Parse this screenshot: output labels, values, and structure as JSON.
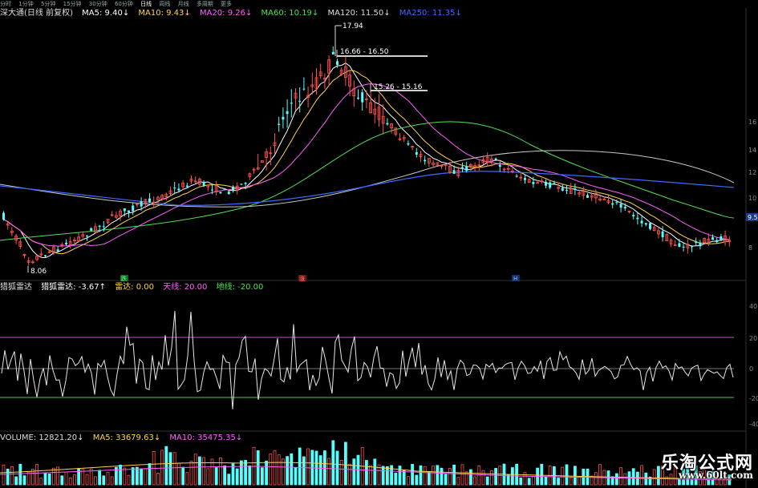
{
  "toolbar": {
    "items": [
      "分时",
      "1分钟",
      "5分钟",
      "15分钟",
      "30分钟",
      "60分钟",
      "日线",
      "周线",
      "月线",
      "多周期",
      "更多"
    ],
    "active_index": 6
  },
  "header": {
    "name": "深大通(日线 前复权)",
    "ma5": "MA5: 9.40↓",
    "ma10": "MA10: 9.43↓",
    "ma20": "MA20: 9.26↓",
    "ma60": "MA60: 10.19↓",
    "ma120": "MA120: 11.50↓",
    "ma250": "MA250: 11.35↓"
  },
  "annotations": {
    "high": "17.94",
    "low": "8.06",
    "box1": "16.66 - 16.50",
    "box2": "15.26 - 15.16",
    "mark_a": "跌",
    "mark_b": "涨",
    "mark_c": "H"
  },
  "price_axis": [
    "16",
    "14",
    "12",
    "10",
    "9.5",
    "8"
  ],
  "indicator": {
    "title": "猎狐雷达",
    "value": "猎狐雷达: -3.67↑",
    "leida": "雷达: 0.00",
    "tian": "天线: 20.00",
    "di": "地线: -20.00",
    "axis": [
      "40",
      "20",
      "0",
      "-20",
      "-40"
    ]
  },
  "volume": {
    "title": "VOLUME: 12821.20↓",
    "ma5": "MA5: 33679.63↓",
    "ma10": "MA10: 35475.35↓"
  },
  "watermark": {
    "cn": "乐淘公式网",
    "url": "www.60lt.com"
  },
  "colors": {
    "up": "#ff5050",
    "down": "#54ffff",
    "ma5": "#ffffff",
    "ma10": "#ffd24d",
    "ma20": "#ff60ff",
    "ma60": "#52e052",
    "ma120": "#3c6bff",
    "tian": "#c050c0",
    "di": "#50c050"
  }
}
